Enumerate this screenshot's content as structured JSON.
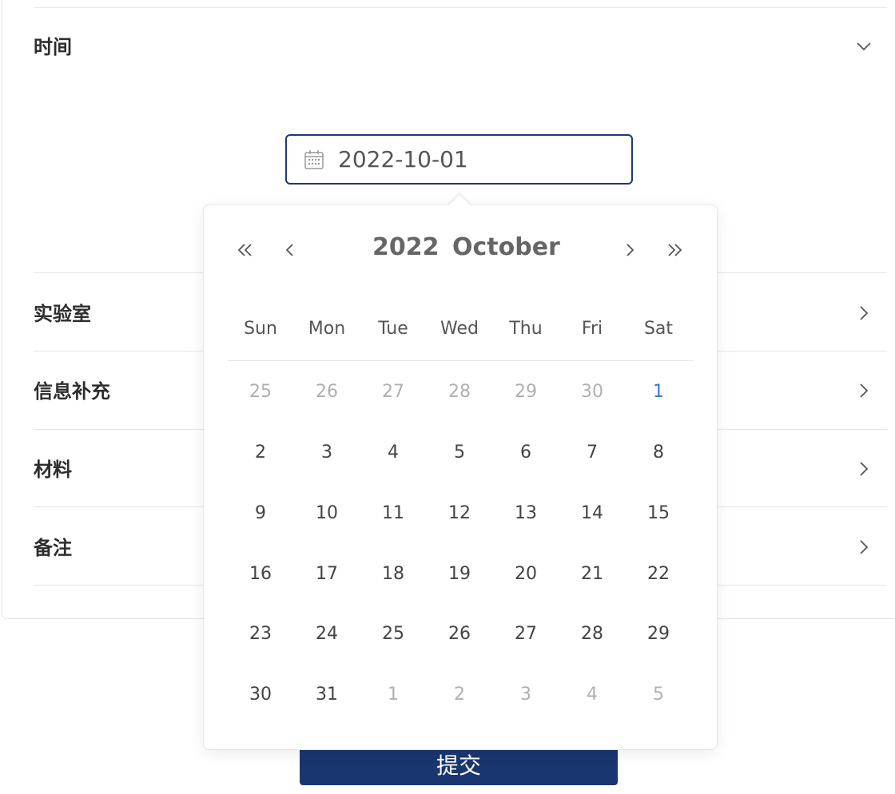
{
  "sections": {
    "time": {
      "title": "时间"
    },
    "lab": {
      "title": "实验室"
    },
    "info": {
      "title": "信息补充"
    },
    "material": {
      "title": "材料"
    },
    "remark": {
      "title": "备注"
    }
  },
  "date_input": {
    "value": "2022-10-01"
  },
  "calendar": {
    "year": "2022",
    "month": "October",
    "weekdays": [
      "Sun",
      "Mon",
      "Tue",
      "Wed",
      "Thu",
      "Fri",
      "Sat"
    ],
    "weeks": [
      [
        "25",
        "26",
        "27",
        "28",
        "29",
        "30",
        "1"
      ],
      [
        "2",
        "3",
        "4",
        "5",
        "6",
        "7",
        "8"
      ],
      [
        "9",
        "10",
        "11",
        "12",
        "13",
        "14",
        "15"
      ],
      [
        "16",
        "17",
        "18",
        "19",
        "20",
        "21",
        "22"
      ],
      [
        "23",
        "24",
        "25",
        "26",
        "27",
        "28",
        "29"
      ],
      [
        "30",
        "31",
        "1",
        "2",
        "3",
        "4",
        "5"
      ]
    ],
    "selected": "1",
    "accent_color": "#2f7bd8"
  },
  "submit": {
    "label": "提交"
  },
  "colors": {
    "primary": "#1a3670",
    "input_border": "#1d3a6e"
  }
}
